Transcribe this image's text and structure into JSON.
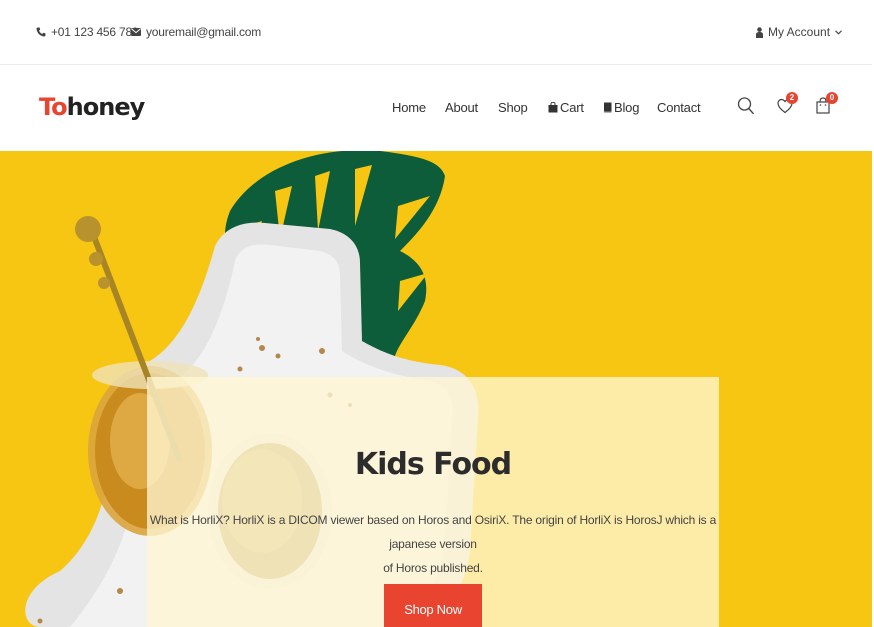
{
  "topbar": {
    "phone": "+01 123 456 789",
    "email": "youremail@gmail.com",
    "account_label": "My Account"
  },
  "header": {
    "logo_accent": "To",
    "logo_rest": "honey",
    "nav": {
      "home": "Home",
      "about": "About",
      "shop": "Shop",
      "cart": "Cart",
      "blog": "Blog",
      "contact": "Contact"
    },
    "wishlist_count": "2",
    "cart_count": "0"
  },
  "hero": {
    "title": "Kids Food",
    "text_line1": "What is HorliX? HorliX is a DICOM viewer based on Horos and OsiriX. The origin of HorliX is HorosJ which is a japanese version",
    "text_line2": "of Horos published.",
    "button_label": "Shop Now"
  },
  "colors": {
    "accent": "#e8442f",
    "hero_background": "#f7c613",
    "leaf": "#0d5c3a"
  },
  "icons": [
    "phone-icon",
    "envelope-icon",
    "user-icon",
    "chevron-down-icon",
    "bag-icon",
    "book-icon",
    "search-icon",
    "heart-icon",
    "cart-icon"
  ]
}
